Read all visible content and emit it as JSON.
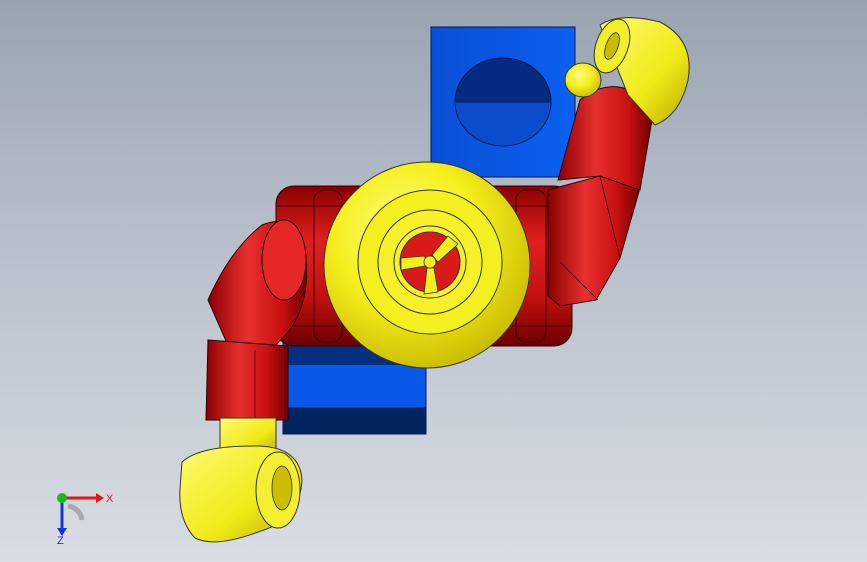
{
  "viewport": {
    "background_top": "#9aa4b1",
    "background_bottom": "#d9dde4"
  },
  "model": {
    "colors": {
      "base_blue": "#0a55e0",
      "base_blue_dark": "#04287a",
      "link_red": "#d01010",
      "link_red_dark": "#7a0000",
      "joint_yellow": "#f2ee22",
      "joint_yellow_dark": "#b8a800"
    }
  },
  "triad": {
    "x_label": "X",
    "z_label": "Z",
    "x_color": "#e01818",
    "y_color": "#18b818",
    "z_color": "#1830e0"
  }
}
